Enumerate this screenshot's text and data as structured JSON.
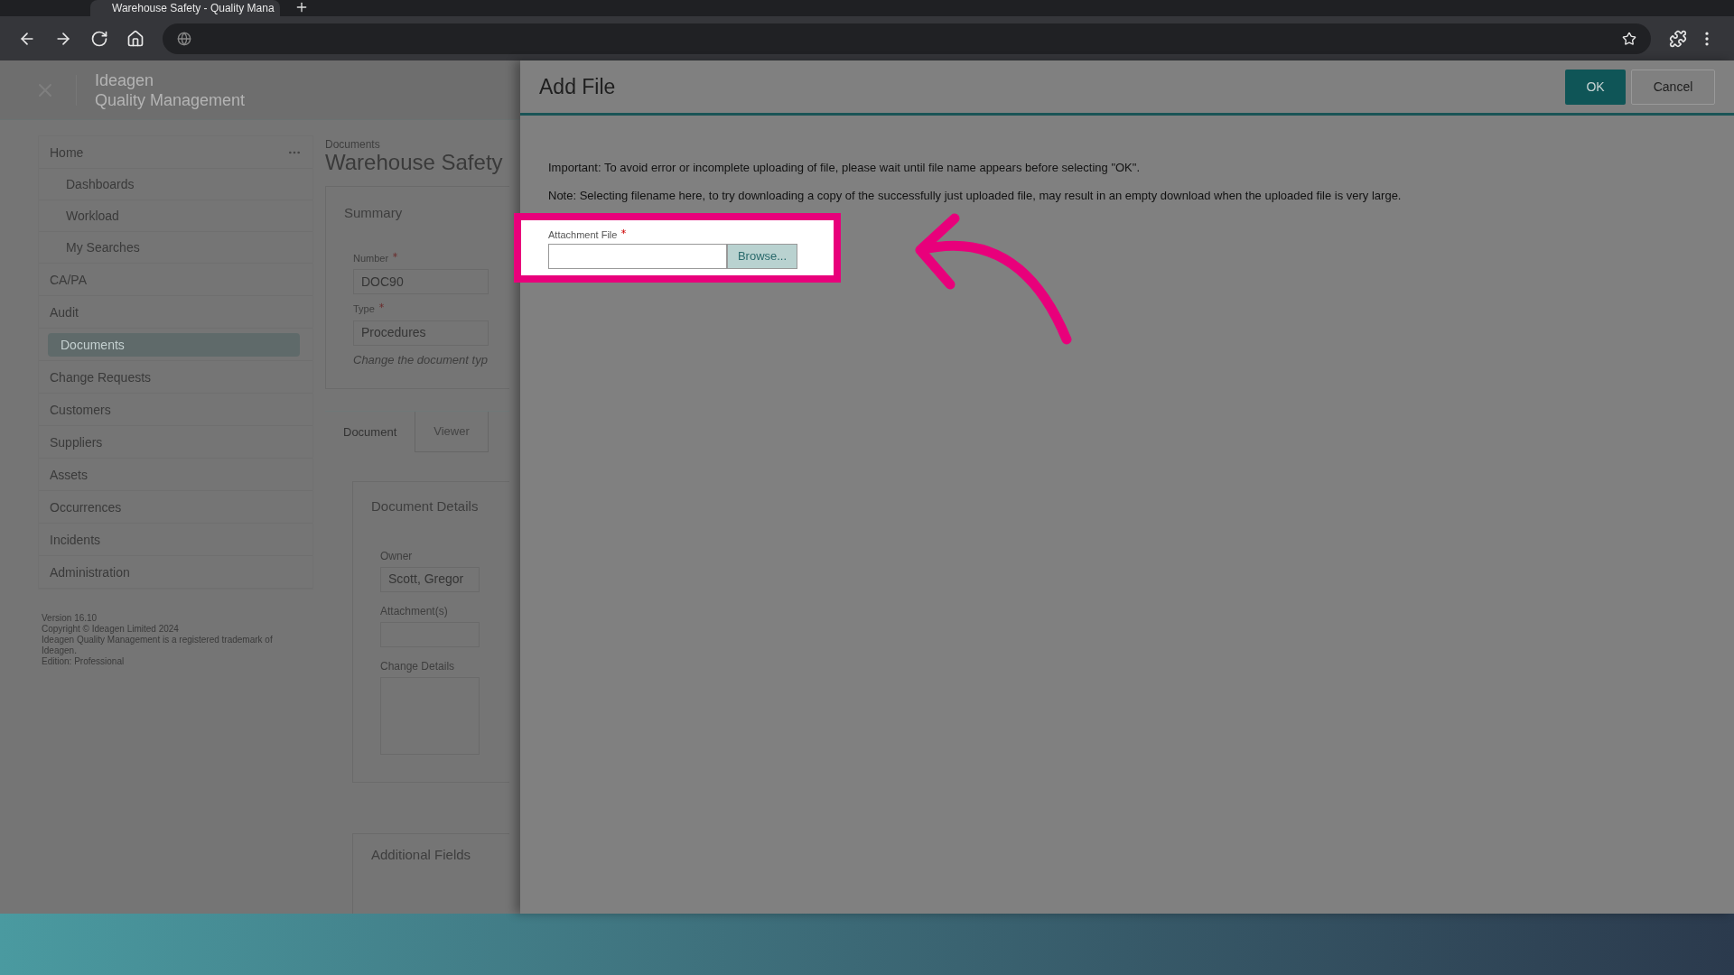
{
  "browser": {
    "tab_title": "Warehouse Safety - Quality Mana"
  },
  "app": {
    "logo": "Ideagen",
    "product": "Quality Management",
    "sidebar": {
      "items": [
        {
          "label": "Home",
          "selected": false,
          "children": [
            {
              "label": "Dashboards",
              "selected": false
            },
            {
              "label": "Workload",
              "selected": false
            },
            {
              "label": "My Searches",
              "selected": false
            }
          ]
        },
        {
          "label": "CA/PA",
          "selected": false
        },
        {
          "label": "Audit",
          "selected": false
        },
        {
          "label": "Documents",
          "selected": true
        },
        {
          "label": "Change Requests",
          "selected": false
        },
        {
          "label": "Customers",
          "selected": false
        },
        {
          "label": "Suppliers",
          "selected": false
        },
        {
          "label": "Assets",
          "selected": false
        },
        {
          "label": "Occurrences",
          "selected": false
        },
        {
          "label": "Incidents",
          "selected": false
        },
        {
          "label": "Administration",
          "selected": false
        }
      ],
      "footer": [
        "Version 16.10",
        "Copyright © Ideagen Limited 2024",
        "Ideagen Quality Management is a registered trademark of Ideagen.",
        "Edition: Professional"
      ]
    },
    "breadcrumb": "Documents",
    "title": "Warehouse Safety",
    "summary": {
      "heading": "Summary",
      "fields": [
        {
          "label": "Number",
          "required": true,
          "value": "DOC90"
        },
        {
          "label": "Type",
          "required": true,
          "value": "Procedures"
        }
      ],
      "note": "Change the document typ"
    },
    "tabs": [
      {
        "label": "Document",
        "selected": true
      },
      {
        "label": "Viewer",
        "selected": false
      }
    ],
    "details": {
      "heading": "Document Details",
      "fields": [
        {
          "label": "Owner",
          "value": "Scott, Gregor",
          "kind": "input"
        },
        {
          "label": "Attachment(s)",
          "kind": "input"
        },
        {
          "label": "Change Details",
          "kind": "textarea"
        }
      ]
    },
    "additional": {
      "heading": "Additional Fields"
    }
  },
  "dialog": {
    "title": "Add File",
    "buttons": [
      {
        "label": "OK",
        "kind": "primary"
      },
      {
        "label": "Cancel",
        "kind": "secondary"
      }
    ],
    "notes": [
      "Important: To avoid error or incomplete uploading of file, please wait until file name appears before selecting \"OK\".",
      "Note: Selecting filename here, to try downloading a copy of the successfully just uploaded file, may result in an empty download when the uploaded file is very large."
    ],
    "attachment": {
      "label": "Attachment File",
      "required": true,
      "button": "Browse..."
    }
  }
}
